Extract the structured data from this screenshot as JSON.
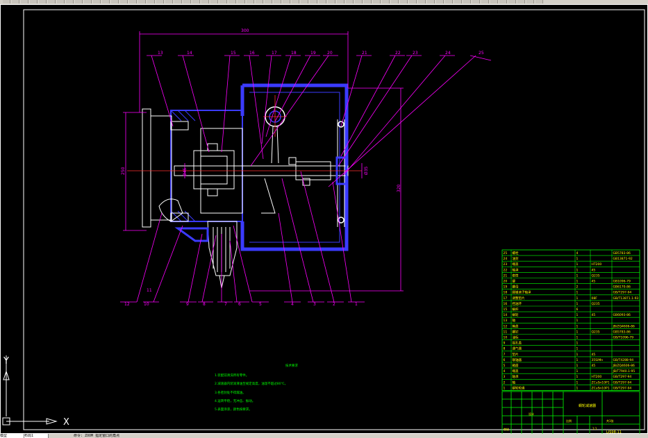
{
  "colors": {
    "background": "#000000",
    "part_outline": "#3b3bff",
    "part_fill_hatch": "#3b3bff",
    "leader_line": "#ff00ff",
    "centerline": "#ff3030",
    "dimension": "#ff00ff",
    "title_block": "#00ff00",
    "text_yellow": "#ffff00",
    "ucs_icon": "#ffffff"
  },
  "balloons_top": [
    "13",
    "14",
    "15",
    "16",
    "17",
    "18",
    "19",
    "20",
    "21",
    "22",
    "23",
    "24",
    "25"
  ],
  "balloons_bottom": [
    "12",
    "11",
    "10",
    "9",
    "8",
    "7",
    "6",
    "5",
    "4",
    "3",
    "2",
    "1"
  ],
  "dimensions": {
    "top_width": "300",
    "left_height": "250",
    "shaft_dia_left": "Ø45",
    "shaft_dia_right": "Ø35",
    "right_height": "320"
  },
  "notes": {
    "heading": "技术要求",
    "lines": [
      "1.装配前清洗所有零件。",
      "2.减速器内装润滑油至规定高度，油温不超过80℃。",
      "3.各密封处不得漏油。",
      "4.运转平稳，无冲击、振动。",
      "5.表面涂漆，颜色按要求。"
    ]
  },
  "parts_list": [
    {
      "no": "25",
      "name": "螺栓",
      "qty": "4",
      "mat": "",
      "std": "GB5783-86"
    },
    {
      "no": "24",
      "name": "油封",
      "qty": "1",
      "mat": "",
      "std": "GB13871-92"
    },
    {
      "no": "23",
      "name": "端盖",
      "qty": "1",
      "mat": "HT200",
      "std": ""
    },
    {
      "no": "22",
      "name": "轴承",
      "qty": "1",
      "mat": "45",
      "std": ""
    },
    {
      "no": "21",
      "name": "套筒",
      "qty": "1",
      "mat": "Q235",
      "std": ""
    },
    {
      "no": "20",
      "name": "键",
      "qty": "1",
      "mat": "45",
      "std": "GB1096-79"
    },
    {
      "no": "19",
      "name": "螺母",
      "qty": "2",
      "mat": "",
      "std": "GB6170-86"
    },
    {
      "no": "18",
      "name": "圆锥滚子轴承",
      "qty": "1",
      "mat": "",
      "std": "GB/T297-94"
    },
    {
      "no": "17",
      "name": "调整垫片",
      "qty": "1",
      "mat": "08F",
      "std": "GB/T13871.1-93"
    },
    {
      "no": "16",
      "name": "挡油环",
      "qty": "1",
      "mat": "Q235",
      "std": ""
    },
    {
      "no": "15",
      "name": "蜗杆",
      "qty": "6",
      "mat": "",
      "std": ""
    },
    {
      "no": "14",
      "name": "蜗轮",
      "qty": "1",
      "mat": "45",
      "std": "GB6093-86"
    },
    {
      "no": "13",
      "name": "轴",
      "qty": "1",
      "mat": "",
      "std": ""
    },
    {
      "no": "12",
      "name": "箱盖",
      "qty": "1",
      "mat": "",
      "std": "JB/ZQ4606-86"
    },
    {
      "no": "11",
      "name": "螺钉",
      "qty": "1",
      "mat": "Q235",
      "std": "GB5783-86"
    },
    {
      "no": "10",
      "name": "油标",
      "qty": "1",
      "mat": "",
      "std": "GB/T1096-79"
    },
    {
      "no": "9",
      "name": "视孔盖",
      "qty": "1",
      "mat": "",
      "std": ""
    },
    {
      "no": "8",
      "name": "通气器",
      "qty": "1",
      "mat": "",
      "std": ""
    },
    {
      "no": "7",
      "name": "垫片",
      "qty": "1",
      "mat": "45",
      "std": ""
    },
    {
      "no": "6",
      "name": "联轴器",
      "qty": "1",
      "mat": "35SiMn",
      "std": "GB/T4288-94"
    },
    {
      "no": "5",
      "name": "箱座",
      "qty": "1",
      "mat": "45",
      "std": "JB/ZQ4606-86"
    },
    {
      "no": "4",
      "name": "端盖",
      "qty": "1",
      "mat": "",
      "std": "JB/T7940.1-95"
    },
    {
      "no": "3",
      "name": "轴承",
      "qty": "1",
      "mat": "HT200",
      "std": "GB/T297-94"
    },
    {
      "no": "2",
      "name": "轴",
      "qty": "1",
      "mat": "ZCuSn10P1",
      "std": "GB/T297-94"
    },
    {
      "no": "1",
      "name": "蜗轮轮缘",
      "qty": "1",
      "mat": "ZCuSn10P1",
      "std": "GB/T297-94"
    }
  ],
  "title_block": {
    "drawing_name": "蜗轮减速器",
    "label_drawn": "设计",
    "label_checked": "审核",
    "label_scale": "比例",
    "scale": "1:1",
    "drawing_no": "LJS98-11",
    "sheet": "共1张"
  },
  "ucs": {
    "x_label": "X",
    "y_label": "Y"
  },
  "status": {
    "tab_model": "模型",
    "tab_layout1": "布局1",
    "command": "命令: ZOOM 指定窗口的角点"
  }
}
